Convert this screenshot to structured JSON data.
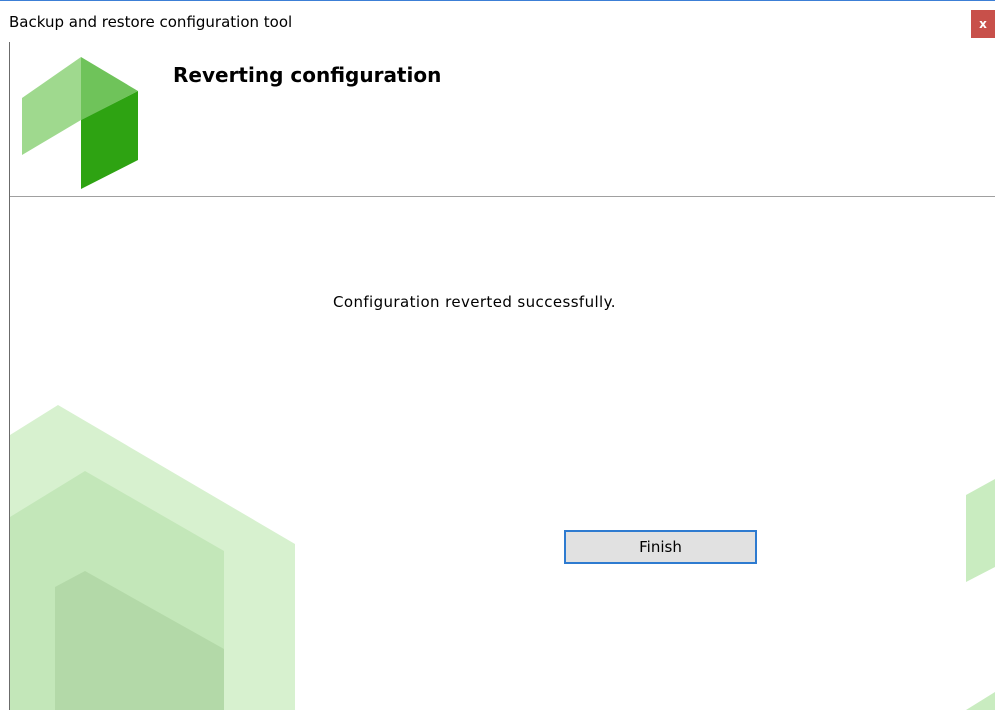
{
  "window": {
    "title": "Backup and restore configuration tool",
    "close_label": "x"
  },
  "header": {
    "heading": "Reverting configuration",
    "logo_icon": "green-hexagon-logo-icon"
  },
  "main": {
    "status_message": "Configuration reverted successfully.",
    "finish_label": "Finish"
  },
  "colors": {
    "close_button": "#c8504a",
    "accent_border": "#2e7bd0",
    "logo_light": "#9fd98e",
    "logo_mid": "#6fc35a",
    "logo_dark": "#2ea312",
    "background_shapes": "#c9ecc0"
  }
}
